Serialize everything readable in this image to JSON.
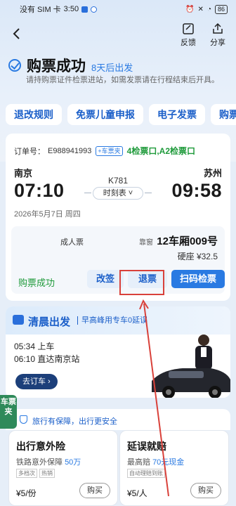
{
  "status_bar": {
    "carrier": "没有 SIM 卡",
    "time": "3:50",
    "battery": "86"
  },
  "nav": {
    "feedback": "反馈",
    "share": "分享"
  },
  "header": {
    "title": "购票成功",
    "depart_hint": "8天后出发",
    "notice": "请持购票证件检票进站，如需发票请在行程结束后开具。"
  },
  "services": [
    "退改规则",
    "免票儿童申报",
    "电子发票",
    "购票"
  ],
  "ticket": {
    "order_label": "订单号：",
    "order_no": "E988941993",
    "car_tag": "+车票夹",
    "gate": "4检票口,A2检票口",
    "from": "南京",
    "to": "苏州",
    "depart_time": "07:10",
    "arrive_time": "09:58",
    "train_no": "K781",
    "timetable": "时刻表",
    "date": "2026年5月7日 周四",
    "passenger_type": "成人票",
    "seat_tag": "靠窗",
    "car_seat": "12车厢009号",
    "fare": "硬座 ¥32.5",
    "status": "购票成功",
    "btn_change": "改签",
    "btn_refund": "退票",
    "btn_scan": "扫码检票"
  },
  "trip": {
    "title": "清晨出发",
    "subtitle": "早高峰用专车0延误",
    "line1": "05:34 上车",
    "line2": "06:10 直达南京站",
    "cta": "去订车"
  },
  "side_tab": "车票夹",
  "insurance": {
    "banner": "旅行有保障，出行更安全",
    "cards": [
      {
        "title": "出行意外险",
        "desc": "铁路意外保障",
        "hl": "50万",
        "tags": [
          "多档次",
          "热销"
        ],
        "price": "¥5/份",
        "buy": "购买"
      },
      {
        "title": "延误就赔",
        "desc": "最高赔",
        "hl": "70元现金",
        "tags": [
          "自动理赔到账"
        ],
        "price": "¥5/人",
        "buy": "购买"
      }
    ]
  },
  "colors": {
    "accent": "#2a7ae2",
    "success": "#1e9a3a",
    "highlight_box": "#d9413a"
  }
}
